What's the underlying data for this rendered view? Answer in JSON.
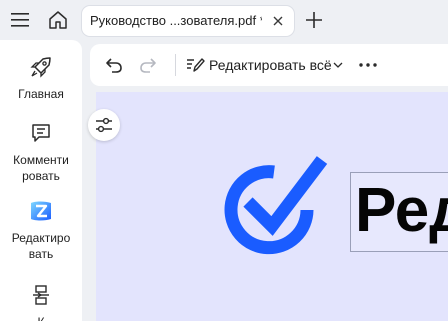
{
  "titlebar": {
    "tab_title": "Руководство ...зователя.pdf *"
  },
  "sidebar": {
    "items": [
      {
        "label": "Главная",
        "icon": "rocket-icon"
      },
      {
        "label": "Комменти ровать",
        "icon": "comment-icon"
      },
      {
        "label": "Редактиро вать",
        "icon": "edit-ai-icon"
      },
      {
        "label": "К",
        "icon": "page-convert-icon"
      }
    ]
  },
  "toolbar": {
    "edit_all_label": "Редактировать всё"
  },
  "document": {
    "heading": "Ред"
  },
  "colors": {
    "accent": "#1a5cff",
    "canvas": "#e3e4fd",
    "sidebar_bg": "#ffffff",
    "chrome_bg": "#eef0f4"
  }
}
